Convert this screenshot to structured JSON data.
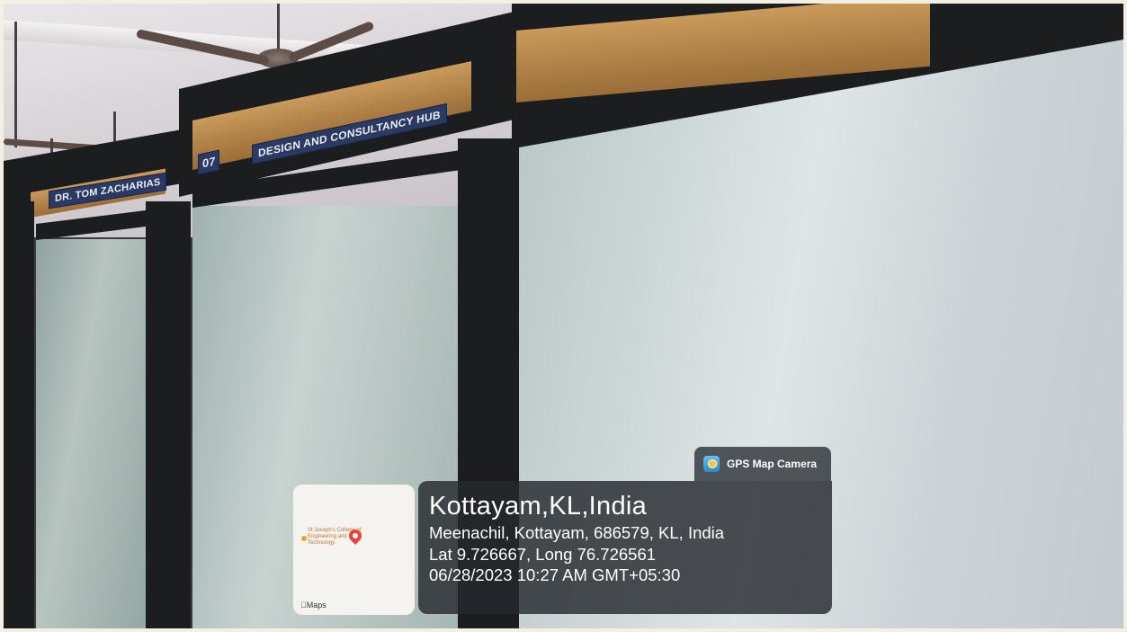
{
  "signs": {
    "left_nameplate": "DR. TOM ZACHARIAS",
    "room_number": "07",
    "room_name": "DESIGN AND CONSULTANCY HUB"
  },
  "gps_overlay": {
    "app_badge": "GPS Map Camera",
    "app_icon": "gps-map-camera-icon",
    "location_title": "Kottayam,KL,India",
    "address": "Meenachil, Kottayam, 686579, KL, India",
    "coordinates": "Lat 9.726667, Long 76.726561",
    "timestamp": "06/28/2023 10:27 AM GMT+05:30"
  },
  "map_thumbnail": {
    "place_label": "St Joseph's College of Engineering and Technology",
    "credit": "Maps",
    "pin_icon": "location-pin-icon"
  },
  "colors": {
    "sign_background": "#2b3a63",
    "panel_background": "#26292e",
    "pin": "#e9433b"
  }
}
